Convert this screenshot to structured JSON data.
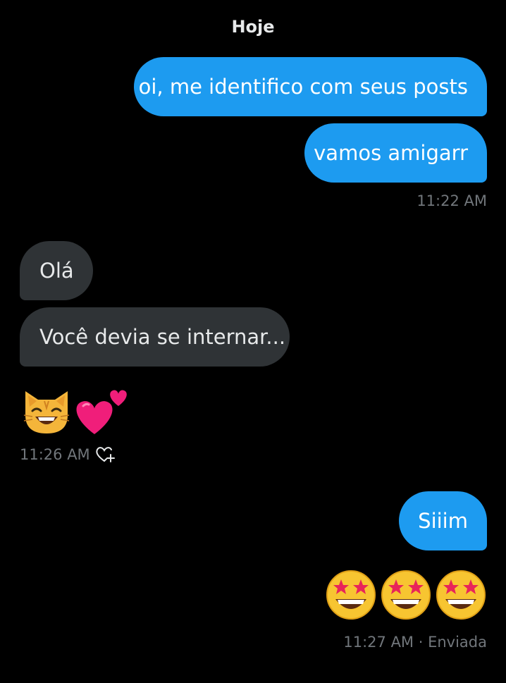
{
  "conversation": {
    "date_separator": "Hoje",
    "messages": [
      {
        "direction": "sent",
        "text": "oi, me identifico com seus posts"
      },
      {
        "direction": "sent",
        "text": "vamos amigarr"
      },
      {
        "direction": "received",
        "text": "Olá"
      },
      {
        "direction": "received",
        "text": "Você devia se internar..."
      },
      {
        "direction": "sent",
        "text": "Siiim"
      }
    ],
    "timestamps": {
      "first_group": "11:22 AM",
      "second_group": "11:26 AM",
      "third_group": "11:27 AM · Enviada"
    },
    "emoji_messages": {
      "received": [
        "smiling-cat-emoji",
        "two-hearts-emoji"
      ],
      "sent": [
        "star-struck-emoji",
        "star-struck-emoji",
        "star-struck-emoji"
      ]
    },
    "reaction_button_icon": "heart-plus-icon"
  },
  "colors": {
    "background": "#000000",
    "sent_bubble": "#1d9bf0",
    "received_bubble": "#2f3336",
    "timestamp": "#71767b",
    "text": "#e7e9ea"
  }
}
